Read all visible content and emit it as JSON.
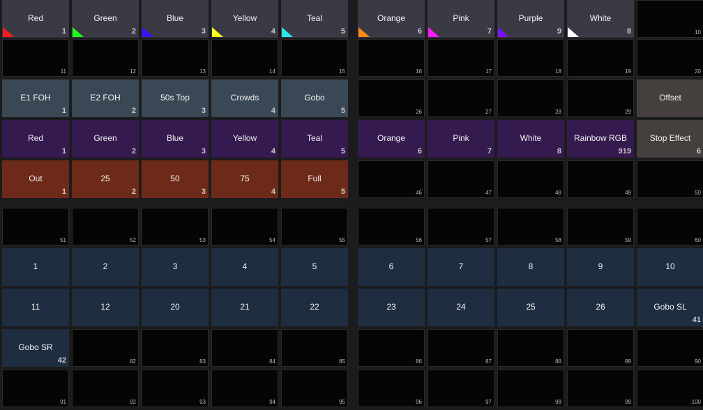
{
  "rows": [
    [
      {
        "label": "Red",
        "num": "1",
        "type": "color",
        "swatch": "#ff1a1a"
      },
      {
        "label": "Green",
        "num": "2",
        "type": "color",
        "swatch": "#1aff1a"
      },
      {
        "label": "Blue",
        "num": "3",
        "type": "color",
        "swatch": "#3a10ff"
      },
      {
        "label": "Yellow",
        "num": "4",
        "type": "color",
        "swatch": "#ffff1a"
      },
      {
        "label": "Teal",
        "num": "5",
        "type": "color",
        "swatch": "#2fe6e6"
      },
      {
        "label": "Orange",
        "num": "6",
        "type": "color",
        "swatch": "#ff8a10"
      },
      {
        "label": "Pink",
        "num": "7",
        "type": "color",
        "swatch": "#ff1aff"
      },
      {
        "label": "Purple",
        "num": "9",
        "type": "color",
        "swatch": "#7a10ff"
      },
      {
        "label": "White",
        "num": "8",
        "type": "color",
        "swatch": "#ffffff"
      },
      {
        "label": "",
        "num": "10",
        "type": "empty"
      }
    ],
    [
      {
        "label": "",
        "num": "11",
        "type": "empty"
      },
      {
        "label": "",
        "num": "12",
        "type": "empty"
      },
      {
        "label": "",
        "num": "13",
        "type": "empty"
      },
      {
        "label": "",
        "num": "14",
        "type": "empty"
      },
      {
        "label": "",
        "num": "15",
        "type": "empty"
      },
      {
        "label": "",
        "num": "16",
        "type": "empty"
      },
      {
        "label": "",
        "num": "17",
        "type": "empty"
      },
      {
        "label": "",
        "num": "18",
        "type": "empty"
      },
      {
        "label": "",
        "num": "19",
        "type": "empty"
      },
      {
        "label": "",
        "num": "20",
        "type": "empty"
      }
    ],
    [
      {
        "label": "E1 FOH",
        "num": "1",
        "type": "pos"
      },
      {
        "label": "E2 FOH",
        "num": "2",
        "type": "pos"
      },
      {
        "label": "50s Top",
        "num": "3",
        "type": "pos"
      },
      {
        "label": "Crowds",
        "num": "4",
        "type": "pos"
      },
      {
        "label": "Gobo",
        "num": "5",
        "type": "pos"
      },
      {
        "label": "",
        "num": "26",
        "type": "empty"
      },
      {
        "label": "",
        "num": "27",
        "type": "empty"
      },
      {
        "label": "",
        "num": "28",
        "type": "empty"
      },
      {
        "label": "",
        "num": "29",
        "type": "empty"
      },
      {
        "label": "Offset",
        "num": "",
        "type": "stop"
      }
    ],
    [
      {
        "label": "Red",
        "num": "1",
        "type": "fx"
      },
      {
        "label": "Green",
        "num": "2",
        "type": "fx"
      },
      {
        "label": "Blue",
        "num": "3",
        "type": "fx"
      },
      {
        "label": "Yellow",
        "num": "4",
        "type": "fx"
      },
      {
        "label": "Teal",
        "num": "5",
        "type": "fx"
      },
      {
        "label": "Orange",
        "num": "6",
        "type": "fx"
      },
      {
        "label": "Pink",
        "num": "7",
        "type": "fx"
      },
      {
        "label": "White",
        "num": "8",
        "type": "fx"
      },
      {
        "label": "Rainbow RGB",
        "num": "919",
        "type": "fx"
      },
      {
        "label": "Stop Effect",
        "num": "6",
        "type": "stop"
      }
    ],
    [
      {
        "label": "Out",
        "num": "1",
        "type": "dim"
      },
      {
        "label": "25",
        "num": "2",
        "type": "dim"
      },
      {
        "label": "50",
        "num": "3",
        "type": "dim"
      },
      {
        "label": "75",
        "num": "4",
        "type": "dim"
      },
      {
        "label": "Full",
        "num": "5",
        "type": "dim"
      },
      {
        "label": "",
        "num": "46",
        "type": "empty"
      },
      {
        "label": "",
        "num": "47",
        "type": "empty"
      },
      {
        "label": "",
        "num": "48",
        "type": "empty"
      },
      {
        "label": "",
        "num": "49",
        "type": "empty"
      },
      {
        "label": "",
        "num": "50",
        "type": "empty"
      }
    ],
    [
      {
        "label": "",
        "num": "51",
        "type": "empty"
      },
      {
        "label": "",
        "num": "52",
        "type": "empty"
      },
      {
        "label": "",
        "num": "53",
        "type": "empty"
      },
      {
        "label": "",
        "num": "54",
        "type": "empty"
      },
      {
        "label": "",
        "num": "55",
        "type": "empty"
      },
      {
        "label": "",
        "num": "56",
        "type": "empty"
      },
      {
        "label": "",
        "num": "57",
        "type": "empty"
      },
      {
        "label": "",
        "num": "58",
        "type": "empty"
      },
      {
        "label": "",
        "num": "59",
        "type": "empty"
      },
      {
        "label": "",
        "num": "60",
        "type": "empty"
      }
    ],
    [
      {
        "label": "1",
        "num": "",
        "type": "grp"
      },
      {
        "label": "2",
        "num": "",
        "type": "grp"
      },
      {
        "label": "3",
        "num": "",
        "type": "grp"
      },
      {
        "label": "4",
        "num": "",
        "type": "grp"
      },
      {
        "label": "5",
        "num": "",
        "type": "grp"
      },
      {
        "label": "6",
        "num": "",
        "type": "grp"
      },
      {
        "label": "7",
        "num": "",
        "type": "grp"
      },
      {
        "label": "8",
        "num": "",
        "type": "grp"
      },
      {
        "label": "9",
        "num": "",
        "type": "grp"
      },
      {
        "label": "10",
        "num": "",
        "type": "grp"
      }
    ],
    [
      {
        "label": "11",
        "num": "",
        "type": "grp"
      },
      {
        "label": "12",
        "num": "",
        "type": "grp"
      },
      {
        "label": "20",
        "num": "",
        "type": "grp"
      },
      {
        "label": "21",
        "num": "",
        "type": "grp"
      },
      {
        "label": "22",
        "num": "",
        "type": "grp"
      },
      {
        "label": "23",
        "num": "",
        "type": "grp"
      },
      {
        "label": "24",
        "num": "",
        "type": "grp"
      },
      {
        "label": "25",
        "num": "",
        "type": "grp"
      },
      {
        "label": "26",
        "num": "",
        "type": "grp"
      },
      {
        "label": "Gobo SL",
        "num": "41",
        "type": "grp"
      }
    ],
    [
      {
        "label": "Gobo SR",
        "num": "42",
        "type": "grp"
      },
      {
        "label": "",
        "num": "82",
        "type": "empty"
      },
      {
        "label": "",
        "num": "83",
        "type": "empty"
      },
      {
        "label": "",
        "num": "84",
        "type": "empty"
      },
      {
        "label": "",
        "num": "85",
        "type": "empty"
      },
      {
        "label": "",
        "num": "86",
        "type": "empty"
      },
      {
        "label": "",
        "num": "87",
        "type": "empty"
      },
      {
        "label": "",
        "num": "88",
        "type": "empty"
      },
      {
        "label": "",
        "num": "89",
        "type": "empty"
      },
      {
        "label": "",
        "num": "90",
        "type": "empty"
      }
    ],
    [
      {
        "label": "",
        "num": "91",
        "type": "empty"
      },
      {
        "label": "",
        "num": "92",
        "type": "empty"
      },
      {
        "label": "",
        "num": "93",
        "type": "empty"
      },
      {
        "label": "",
        "num": "94",
        "type": "empty"
      },
      {
        "label": "",
        "num": "95",
        "type": "empty"
      },
      {
        "label": "",
        "num": "96",
        "type": "empty"
      },
      {
        "label": "",
        "num": "97",
        "type": "empty"
      },
      {
        "label": "",
        "num": "98",
        "type": "empty"
      },
      {
        "label": "",
        "num": "99",
        "type": "empty"
      },
      {
        "label": "",
        "num": "100",
        "type": "empty"
      }
    ]
  ]
}
